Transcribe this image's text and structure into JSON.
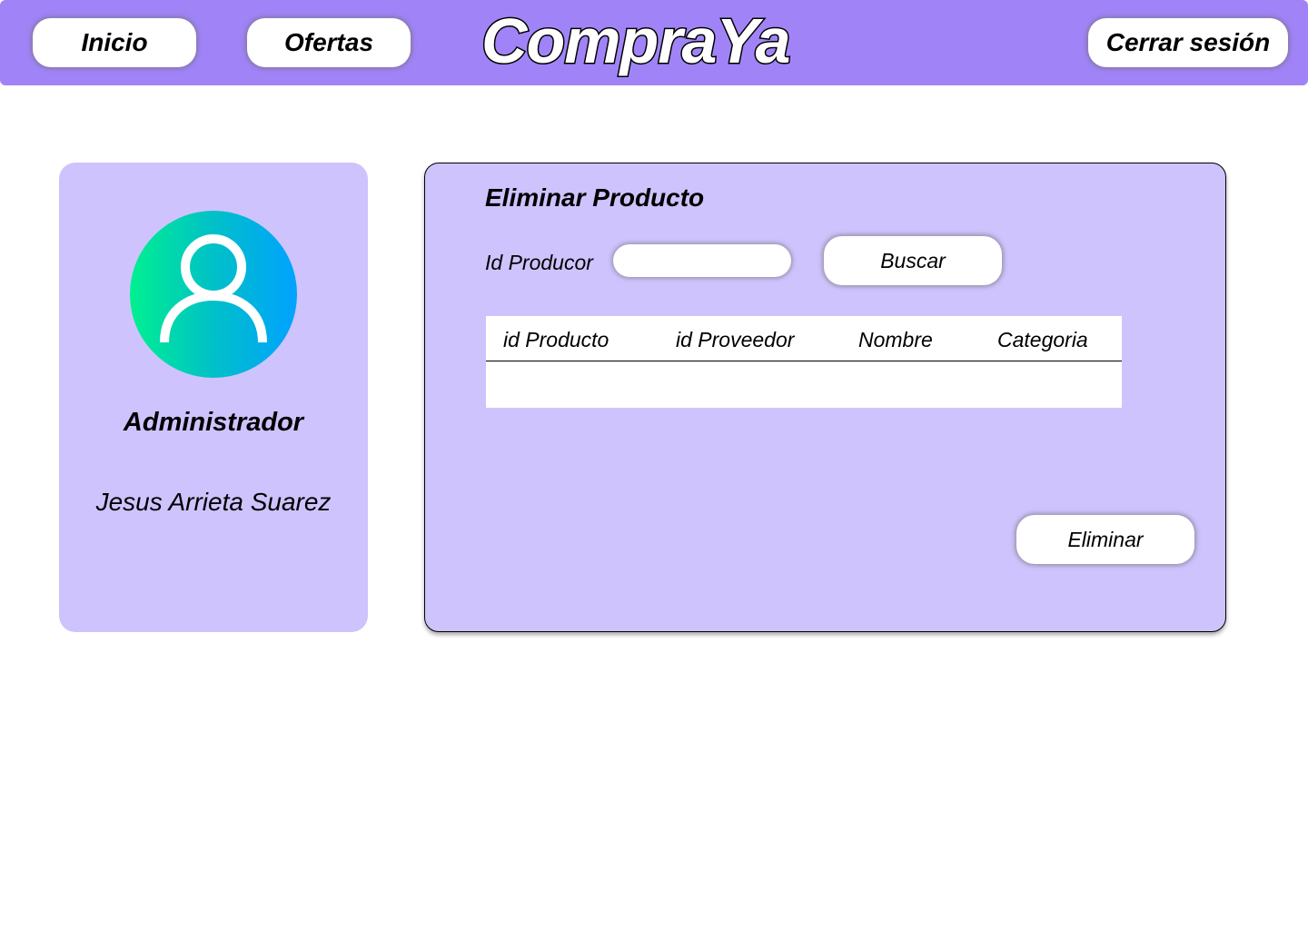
{
  "nav": {
    "inicio_label": "Inicio",
    "ofertas_label": "Ofertas",
    "brand": "CompraYa",
    "logout_label": "Cerrar sesión"
  },
  "profile": {
    "role": "Administrador",
    "name": "Jesus Arrieta Suarez",
    "avatar_icon": "user-icon"
  },
  "panel": {
    "title": "Eliminar Producto",
    "id_label": "Id Producor",
    "id_input_value": "",
    "search_label": "Buscar",
    "delete_label": "Eliminar",
    "table": {
      "columns": [
        "id Producto",
        "id Proveedor",
        "Nombre",
        "Categoria"
      ],
      "rows": []
    }
  },
  "colors": {
    "header_bg": "#a084f7",
    "card_bg": "#cfc3fd",
    "avatar_gradient_start": "#00f090",
    "avatar_gradient_end": "#00a2ff"
  }
}
